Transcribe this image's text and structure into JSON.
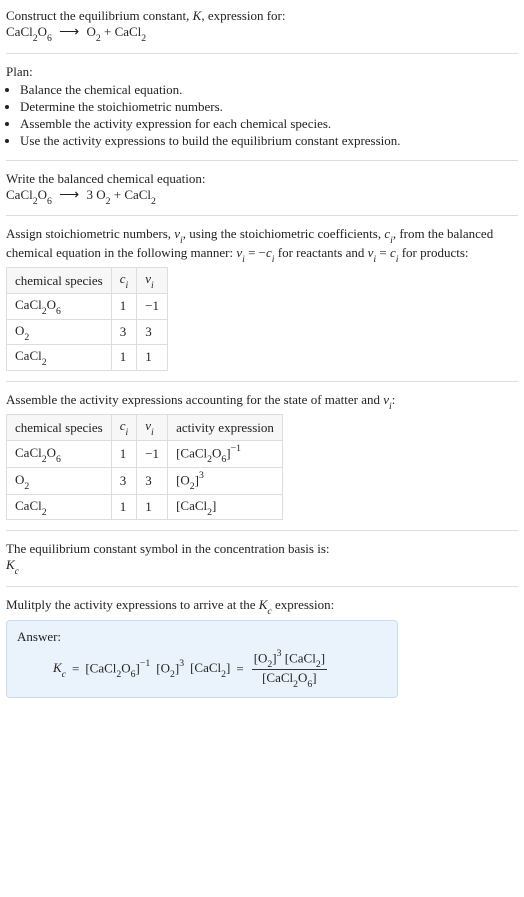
{
  "intro": {
    "line1": "Construct the equilibrium constant, ",
    "K": "K",
    "line1b": ", expression for:",
    "eq_lhs": "CaCl",
    "eq_lhs_sub1": "2",
    "eq_lhs_mid": "O",
    "eq_lhs_sub2": "6",
    "arrow": "⟶",
    "eq_rhs_a": "O",
    "eq_rhs_a_sub": "2",
    "plus": " + ",
    "eq_rhs_b": "CaCl",
    "eq_rhs_b_sub": "2"
  },
  "plan": {
    "heading": "Plan:",
    "items": [
      "Balance the chemical equation.",
      "Determine the stoichiometric numbers.",
      "Assemble the activity expression for each chemical species.",
      "Use the activity expressions to build the equilibrium constant expression."
    ]
  },
  "balanced": {
    "heading": "Write the balanced chemical equation:",
    "lhs": "CaCl",
    "lhs_s1": "2",
    "lhs_mid": "O",
    "lhs_s2": "6",
    "arrow": "⟶",
    "coef": "3",
    "r1": "O",
    "r1_sub": "2",
    "plus": " + ",
    "r2": "CaCl",
    "r2_sub": "2"
  },
  "assign": {
    "text_a": "Assign stoichiometric numbers, ",
    "nu": "ν",
    "sub_i": "i",
    "text_b": ", using the stoichiometric coefficients, ",
    "c": "c",
    "text_c": ", from the balanced chemical equation in the following manner: ",
    "eq1_lhs": "ν",
    "eq1_eq": " = −",
    "eq1_rhs": "c",
    "text_d": " for reactants and ",
    "eq2_eq": " = ",
    "text_e": " for products:"
  },
  "table1": {
    "h1": "chemical species",
    "h2": "c",
    "h2_sub": "i",
    "h3": "ν",
    "h3_sub": "i",
    "rows": [
      {
        "sp_a": "CaCl",
        "sp_s1": "2",
        "sp_b": "O",
        "sp_s2": "6",
        "ci": "1",
        "vi": "−1"
      },
      {
        "sp_a": "O",
        "sp_s1": "2",
        "sp_b": "",
        "sp_s2": "",
        "ci": "3",
        "vi": "3"
      },
      {
        "sp_a": "CaCl",
        "sp_s1": "2",
        "sp_b": "",
        "sp_s2": "",
        "ci": "1",
        "vi": "1"
      }
    ]
  },
  "assemble": {
    "text_a": "Assemble the activity expressions accounting for the state of matter and ",
    "nu": "ν",
    "sub_i": "i",
    "text_b": ":"
  },
  "table2": {
    "h1": "chemical species",
    "h2": "c",
    "h2_sub": "i",
    "h3": "ν",
    "h3_sub": "i",
    "h4": "activity expression",
    "rows": [
      {
        "sp_a": "CaCl",
        "sp_s1": "2",
        "sp_b": "O",
        "sp_s2": "6",
        "ci": "1",
        "vi": "−1",
        "ae_a": "[CaCl",
        "ae_s1": "2",
        "ae_b": "O",
        "ae_s2": "6",
        "ae_c": "]",
        "ae_exp": "−1"
      },
      {
        "sp_a": "O",
        "sp_s1": "2",
        "sp_b": "",
        "sp_s2": "",
        "ci": "3",
        "vi": "3",
        "ae_a": "[O",
        "ae_s1": "2",
        "ae_b": "",
        "ae_s2": "",
        "ae_c": "]",
        "ae_exp": "3"
      },
      {
        "sp_a": "CaCl",
        "sp_s1": "2",
        "sp_b": "",
        "sp_s2": "",
        "ci": "1",
        "vi": "1",
        "ae_a": "[CaCl",
        "ae_s1": "2",
        "ae_b": "",
        "ae_s2": "",
        "ae_c": "]",
        "ae_exp": ""
      }
    ]
  },
  "symbol": {
    "text": "The equilibrium constant symbol in the concentration basis is:",
    "K": "K",
    "sub": "c"
  },
  "multiply": {
    "text_a": "Mulitply the activity expressions to arrive at the ",
    "K": "K",
    "sub": "c",
    "text_b": " expression:"
  },
  "answer": {
    "label": "Answer:",
    "K": "K",
    "Ksub": "c",
    "eq": " = ",
    "t1_a": "[CaCl",
    "t1_s1": "2",
    "t1_b": "O",
    "t1_s2": "6",
    "t1_c": "]",
    "t1_exp": "−1",
    "sp": " ",
    "t2_a": "[O",
    "t2_s1": "2",
    "t2_c": "]",
    "t2_exp": "3",
    "t3_a": "[CaCl",
    "t3_s1": "2",
    "t3_c": "]",
    "eq2": " = ",
    "num_a": "[O",
    "num_s1": "2",
    "num_c": "]",
    "num_exp": "3",
    "num_sp": " ",
    "num_b": "[CaCl",
    "num_bs1": "2",
    "num_bc": "]",
    "den_a": "[CaCl",
    "den_s1": "2",
    "den_b": "O",
    "den_s2": "6",
    "den_c": "]"
  }
}
